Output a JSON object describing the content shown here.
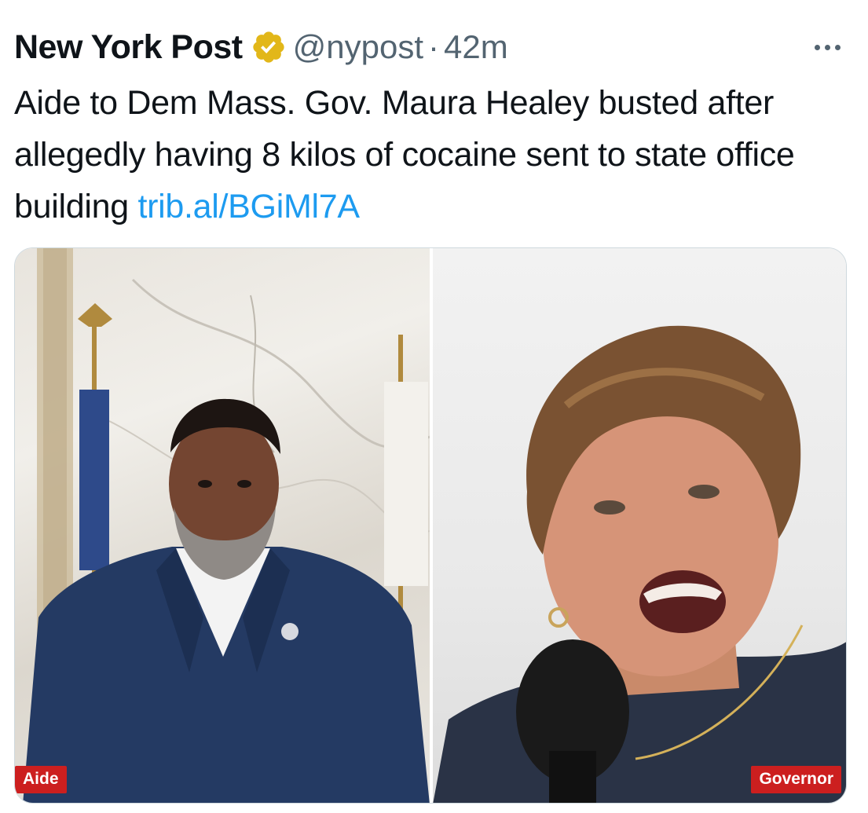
{
  "author": {
    "display_name": "New York Post",
    "handle": "@nypost",
    "separator": "·",
    "time": "42m",
    "verified_icon": "verified-gold-badge-icon"
  },
  "menu": {
    "icon": "more-horizontal-icon"
  },
  "tweet": {
    "text": "Aide to Dem Mass. Gov. Maura Healey busted after allegedly having 8 kilos of cocaine sent to state office building ",
    "link": "trib.al/BGiMl7A"
  },
  "media": {
    "left_caption": "Aide",
    "right_caption": "Governor"
  },
  "colors": {
    "link": "#1d9bf0",
    "secondary_text": "#536471",
    "badge_gold": "#e2b719",
    "caption_red": "#cc1f1f"
  }
}
